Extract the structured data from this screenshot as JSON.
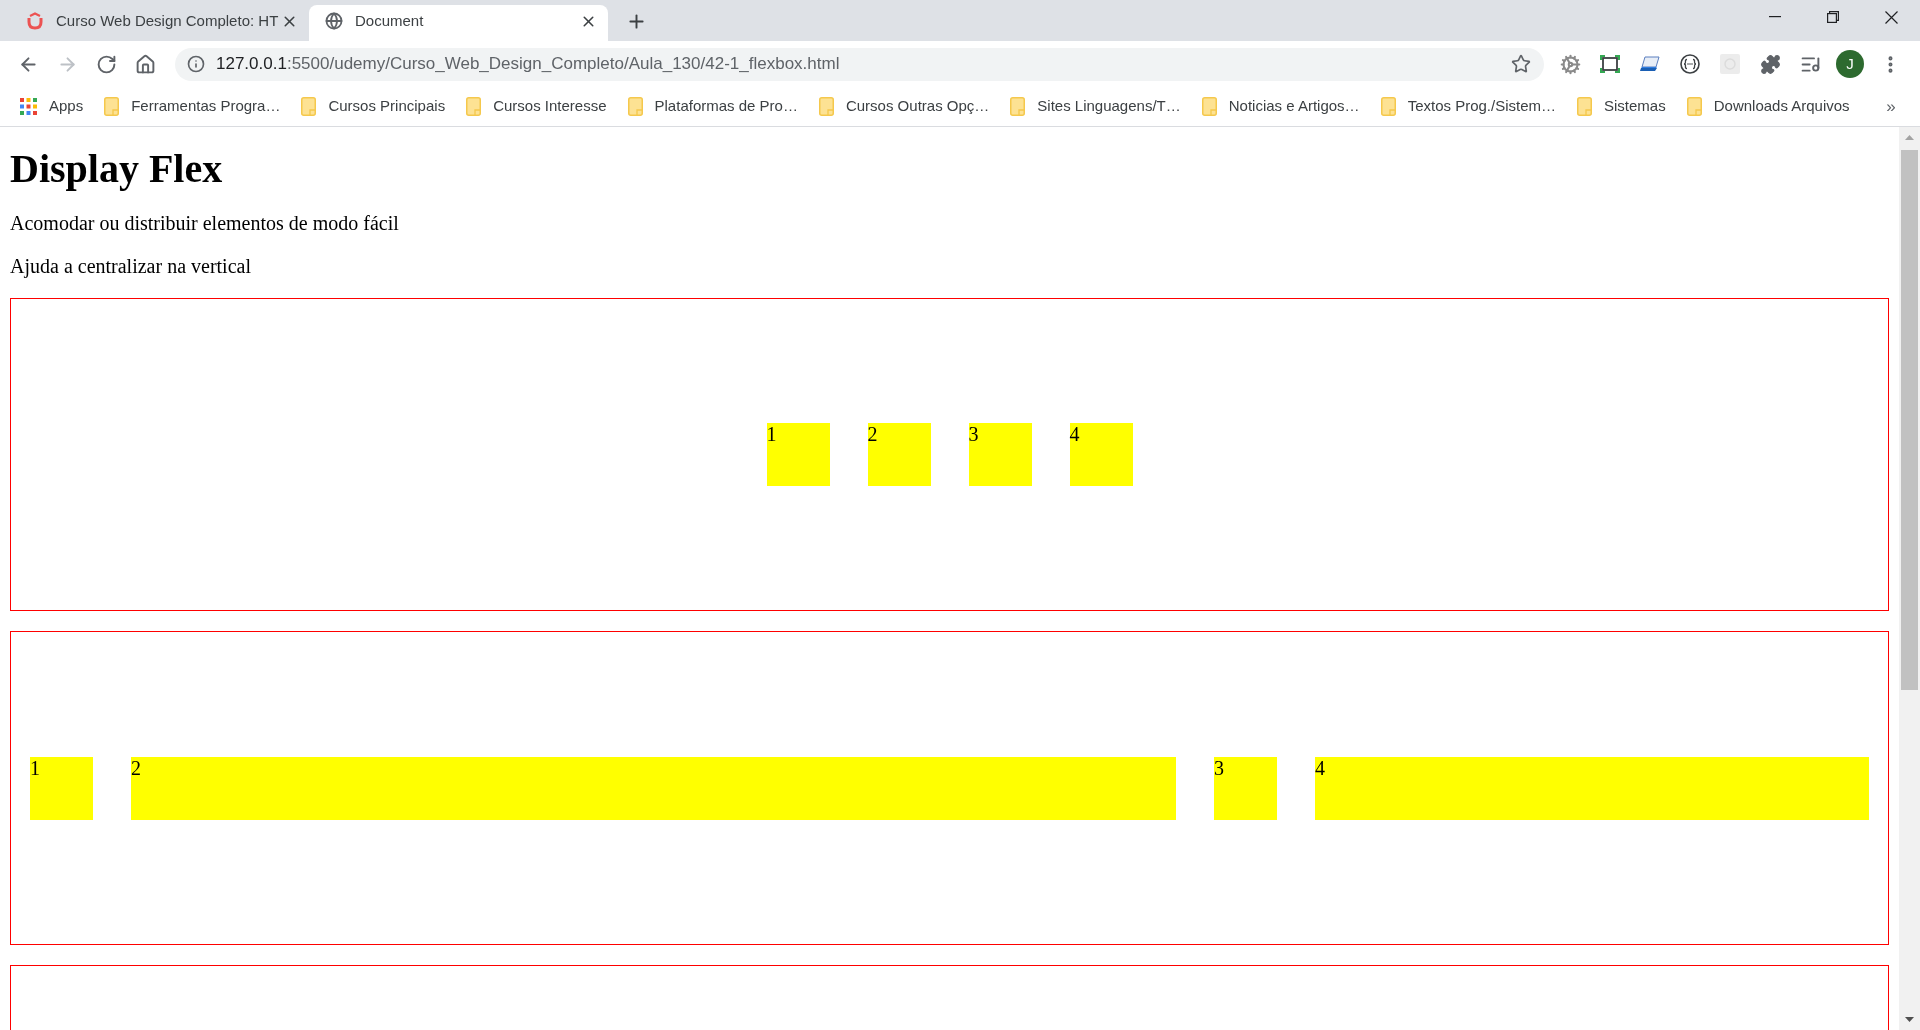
{
  "browser": {
    "tabs": [
      {
        "title": "Curso Web Design Completo: HT",
        "selected": false
      },
      {
        "title": "Document",
        "selected": true
      }
    ],
    "nav": [
      {
        "kind": "back",
        "disabled": false
      },
      {
        "kind": "forward",
        "disabled": true
      },
      {
        "kind": "reload",
        "disabled": false
      },
      {
        "kind": "home",
        "disabled": false
      }
    ],
    "address": {
      "host": "127.0.0.1",
      "path": ":5500/udemy/Curso_Web_Design_Completo/Aula_130/42-1_flexbox.html"
    },
    "profile": {
      "initial": "J"
    },
    "bookmarks": [
      {
        "label": "Apps",
        "kind": "apps"
      },
      {
        "label": "Ferramentas Progra…",
        "kind": "folder"
      },
      {
        "label": "Cursos Principais",
        "kind": "folder"
      },
      {
        "label": "Cursos Interesse",
        "kind": "folder"
      },
      {
        "label": "Plataformas de Pro…",
        "kind": "folder"
      },
      {
        "label": "Cursos Outras Opç…",
        "kind": "folder"
      },
      {
        "label": "Sites Linguagens/T…",
        "kind": "folder"
      },
      {
        "label": "Noticias e Artigos…",
        "kind": "folder"
      },
      {
        "label": "Textos Prog./Sistem…",
        "kind": "folder"
      },
      {
        "label": "Sistemas",
        "kind": "folder"
      },
      {
        "label": "Downloads Arquivos",
        "kind": "folder"
      }
    ],
    "bookmarks_more": "»"
  },
  "page": {
    "heading": "Display Flex",
    "paragraphs": [
      "Acomodar ou distribuir elementos de modo fácil",
      "Ajuda a centralizar na vertical"
    ],
    "containers": [
      {
        "kind": "centered",
        "items": [
          {
            "label": "1",
            "kind": "fixed"
          },
          {
            "label": "2",
            "kind": "fixed"
          },
          {
            "label": "3",
            "kind": "fixed"
          },
          {
            "label": "4",
            "kind": "fixed"
          }
        ]
      },
      {
        "kind": "spread",
        "items": [
          {
            "label": "1",
            "kind": "fixed"
          },
          {
            "label": "2",
            "kind": "wider"
          },
          {
            "label": "3",
            "kind": "fixed"
          },
          {
            "label": "4",
            "kind": "wide"
          }
        ]
      },
      {
        "kind": "cut"
      }
    ]
  }
}
